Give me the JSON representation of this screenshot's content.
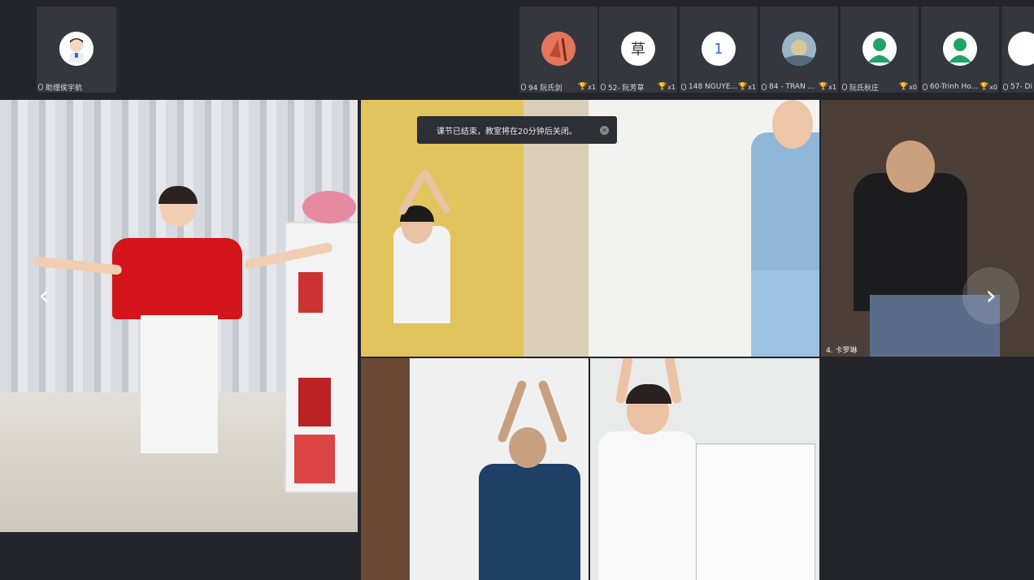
{
  "strip_left": {
    "label": "助理侯宇航"
  },
  "strip_right": [
    {
      "label": "94 阮氏剑",
      "count": "x1",
      "avatar_char": "",
      "avatar_color": "#e2755b"
    },
    {
      "label": "52- 阮芳草",
      "count": "x1",
      "avatar_char": "草",
      "avatar_color": "#ffffff"
    },
    {
      "label": "148 NGUYE...",
      "count": "x1",
      "avatar_char": "1",
      "avatar_color": "#ffffff"
    },
    {
      "label": "84 - TRAN ...",
      "count": "x1",
      "avatar_char": "",
      "avatar_color": "#8fa6b8"
    },
    {
      "label": "阮氏秋庄",
      "count": "x0",
      "avatar_char": "",
      "avatar_color": "#ffffff"
    },
    {
      "label": "60-Trinh Ho...",
      "count": "x0",
      "avatar_char": "",
      "avatar_color": "#ffffff"
    },
    {
      "label": "57- Di",
      "count": "",
      "avatar_char": "",
      "avatar_color": "#ffffff"
    }
  ],
  "toast": {
    "message": "课节已结束，教室将在20分钟后关闭。"
  },
  "video_labels": {
    "tile4": "4. 卡罗琳"
  },
  "colors": {
    "background": "#23252b",
    "tile": "#35373e",
    "trophy": "#f0c419"
  }
}
